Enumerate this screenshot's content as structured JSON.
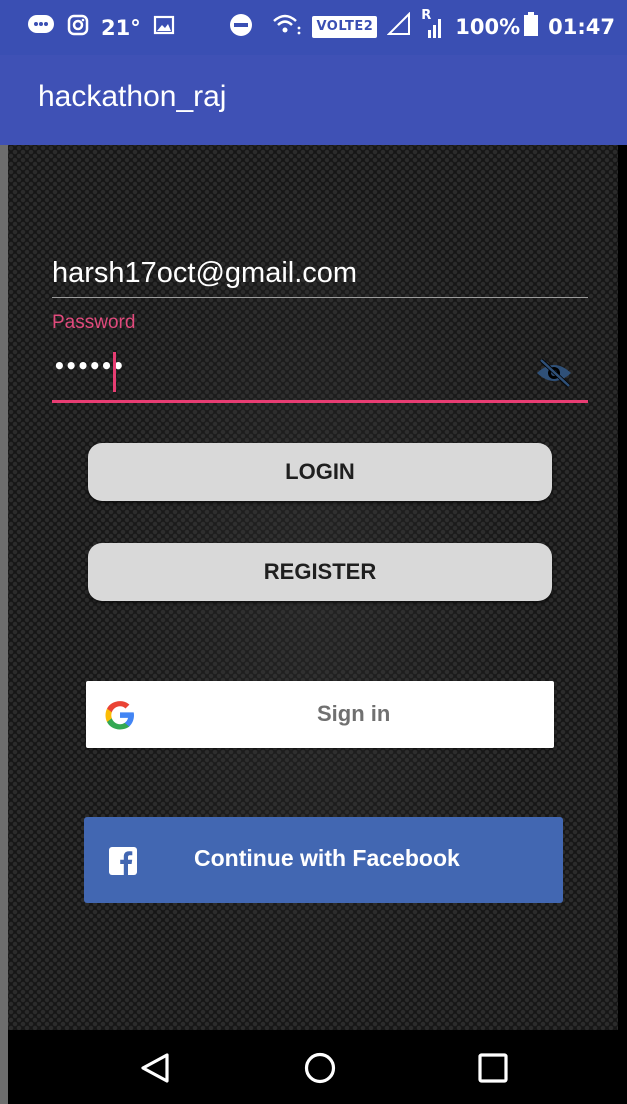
{
  "status_bar": {
    "temperature": "21°",
    "network_badge": "VOLTE2",
    "roaming_mark": "R",
    "battery": "100%",
    "time": "01:47",
    "icons": [
      "chat-icon",
      "instagram-icon",
      "image-icon",
      "dnd-icon",
      "wifi-icon",
      "signal-icon",
      "battery-icon"
    ]
  },
  "toolbar": {
    "title": "hackathon_raj"
  },
  "form": {
    "email_value": "harsh17oct@gmail.com",
    "password_label": "Password",
    "password_masked": "••••••"
  },
  "buttons": {
    "login_label": "LOGIN",
    "register_label": "REGISTER",
    "google_label": "Sign in",
    "facebook_label": "Continue with Facebook"
  },
  "colors": {
    "toolbar": "#3f51b5",
    "status_bar": "#3a4fb3",
    "accent": "#e83d73",
    "facebook": "#4267b2"
  },
  "navigation": {
    "icons": [
      "back-icon",
      "home-icon",
      "recents-icon"
    ]
  }
}
